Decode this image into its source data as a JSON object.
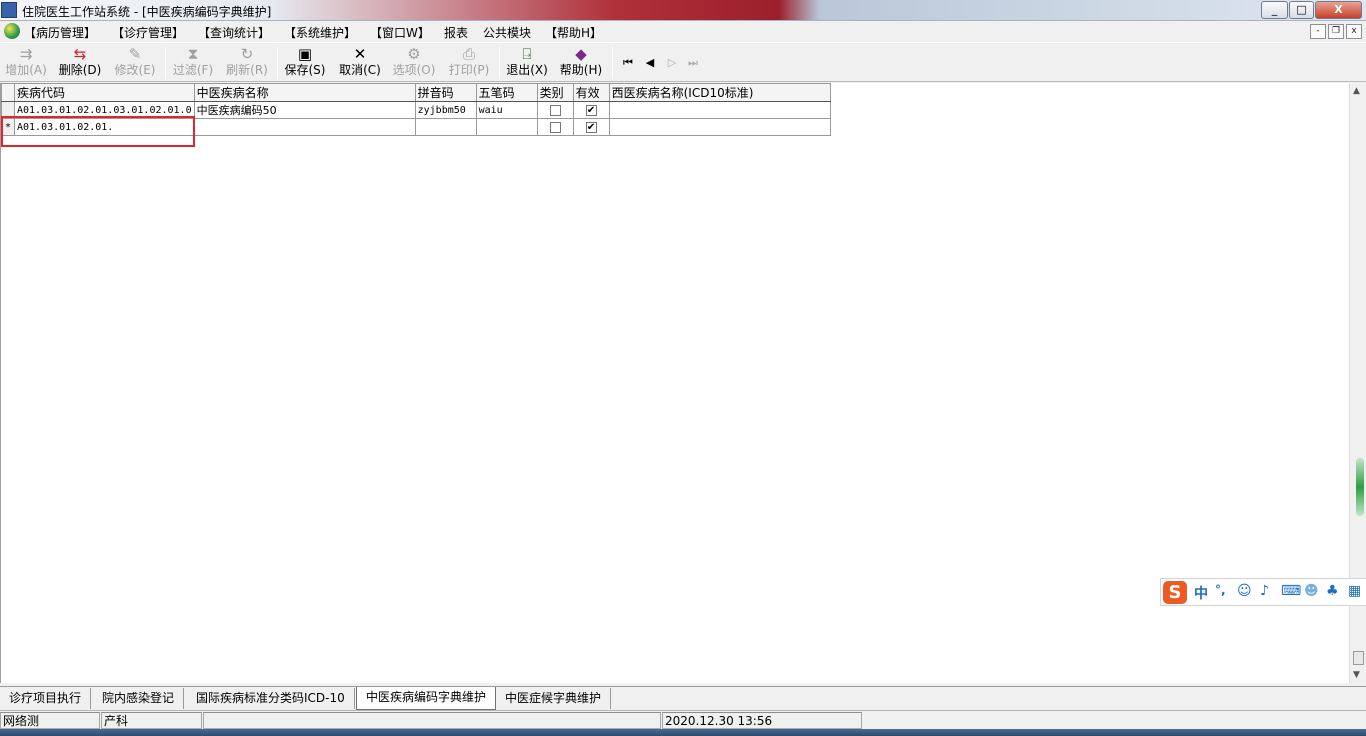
{
  "window": {
    "title": "住院医生工作站系统 - [中医疾病编码字典维护]",
    "controls": [
      "_",
      "□",
      "X"
    ]
  },
  "menu": {
    "items": [
      "【病历管理】",
      "【诊疗管理】",
      "【查询统计】",
      "【系统维护】",
      "【窗口W】",
      "报表",
      "公共模块",
      "【帮助H】"
    ],
    "mdi_controls": [
      "-",
      "❐",
      "x"
    ]
  },
  "toolbar": {
    "add": "增加(A)",
    "delete": "删除(D)",
    "modify": "修改(E)",
    "filter": "过滤(F)",
    "refresh": "刷新(R)",
    "save": "保存(S)",
    "cancel": "取消(C)",
    "options": "选项(O)",
    "print": "打印(P)",
    "exit": "退出(X)",
    "help": "帮助(H)"
  },
  "grid": {
    "columns": [
      "疾病代码",
      "中医疾病名称",
      "拼音码",
      "五笔码",
      "类别",
      "有效",
      "西医疾病名称(ICD10标准)"
    ],
    "rows": [
      {
        "indicator": "",
        "code": "A01.03.01.02.01.03.01.02.01.0",
        "name": "中医疾病编码50",
        "pinyin": "zyjbbm50",
        "wubi": "waiu",
        "category": false,
        "valid": true,
        "western": ""
      },
      {
        "indicator": "*",
        "code": "A01.03.01.02.01.",
        "name": "",
        "pinyin": "",
        "wubi": "",
        "category": false,
        "valid": true,
        "western": ""
      }
    ]
  },
  "ime": {
    "logo": "S",
    "mode": "中",
    "punct": "°,"
  },
  "tabs": [
    "诊疗项目执行",
    "院内感染登记",
    "国际疾病标准分类码ICD-10",
    "中医疾病编码字典维护",
    "中医症候字典维护"
  ],
  "status": {
    "network": "网络测",
    "dept": "产科",
    "datetime": "2020.12.30 13:56"
  },
  "colors": {
    "highlight": "#e3242b"
  }
}
